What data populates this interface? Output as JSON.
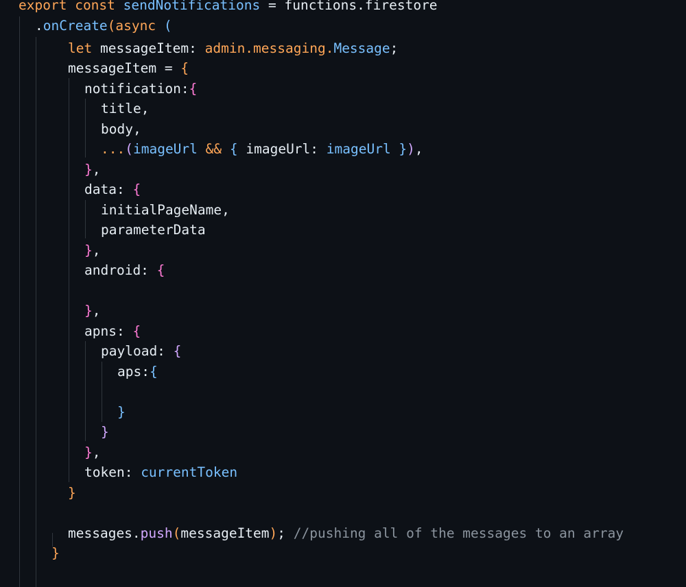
{
  "code": {
    "l1": {
      "export": "export",
      "const": "const",
      "name": "sendNotifications",
      "eq": " = ",
      "target": "functions.firestore"
    },
    "l2": {
      "dot": ".",
      "method": "onCreate",
      "open": "(",
      "async": "async",
      "paren": "("
    },
    "l3": {
      "let": "let",
      "var": "messageItem",
      "colon": ": ",
      "ns": "admin.messaging.",
      "type": "Message",
      "semi": ";"
    },
    "l4": {
      "var": "messageItem",
      "eq": " = ",
      "brace": "{"
    },
    "l5": {
      "key": "notification:",
      "brace": "{"
    },
    "l6": {
      "text": "title,"
    },
    "l7": {
      "text": "body,"
    },
    "l8": {
      "spread": "...",
      "open": "(",
      "v1": "imageUrl",
      "and": " && ",
      "brace": "{",
      "key": " imageUrl: ",
      "v2": "imageUrl",
      "close1": " }",
      "close2": ")",
      "tail": ","
    },
    "l9": {
      "brace": "}",
      "tail": ","
    },
    "l10": {
      "key": "data: ",
      "brace": "{"
    },
    "l11": {
      "text": "initialPageName,"
    },
    "l12": {
      "text": "parameterData"
    },
    "l13": {
      "brace": "}",
      "tail": ","
    },
    "l14": {
      "key": "android: ",
      "brace": "{"
    },
    "l15": {
      "brace": "}",
      "tail": ","
    },
    "l16": {
      "key": "apns: ",
      "brace": "{"
    },
    "l17": {
      "key": "payload: ",
      "brace": "{"
    },
    "l18": {
      "key": "aps:",
      "brace": "{"
    },
    "l19": {
      "brace": "}"
    },
    "l20": {
      "brace": "}"
    },
    "l21": {
      "brace": "}",
      "tail": ","
    },
    "l22": {
      "key": "token: ",
      "value": "currentToken"
    },
    "l23": {
      "brace": "}"
    },
    "l24": {
      "obj": "messages.",
      "method": "push",
      "open": "(",
      "arg": "messageItem",
      "close": ")",
      "semi": "; ",
      "comment": "//pushing all of the messages to an array"
    },
    "l25": {
      "brace": "}"
    }
  }
}
